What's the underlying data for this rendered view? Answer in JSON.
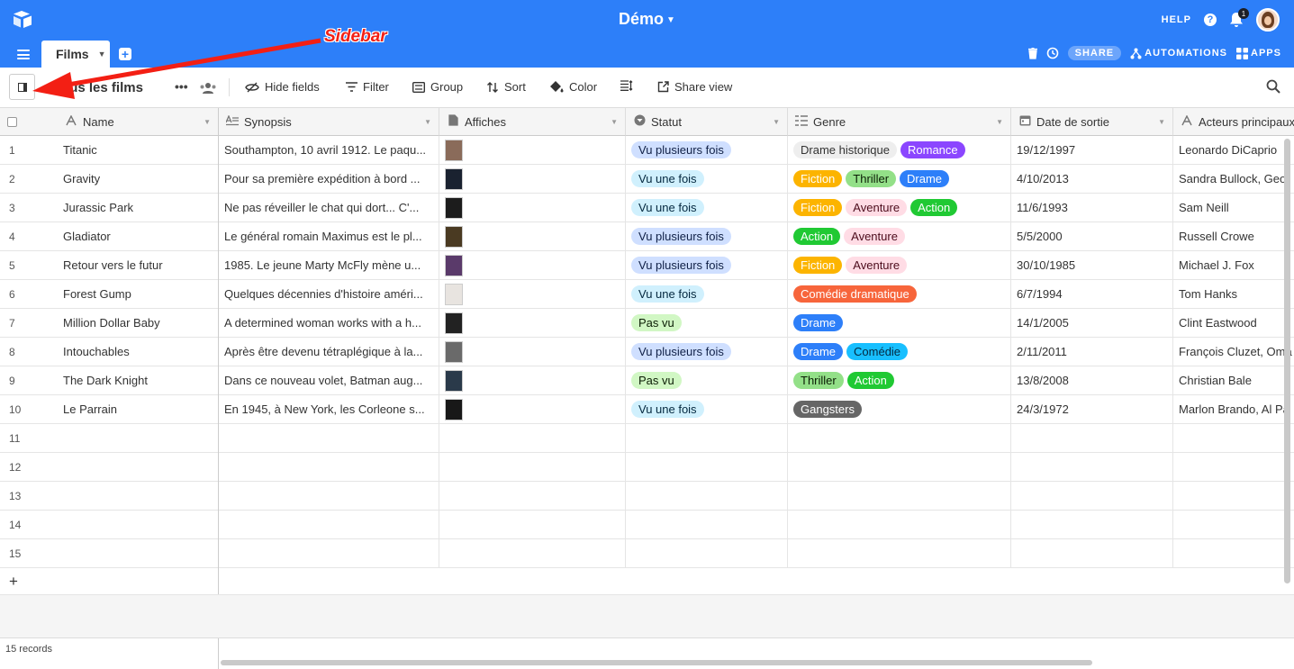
{
  "app": {
    "base_title": "Démo",
    "help_label": "HELP",
    "help_icon_glyph": "?",
    "notification_count": "1"
  },
  "tabs": {
    "active": "Films"
  },
  "tab_actions": {
    "share": "SHARE",
    "automations": "AUTOMATIONS",
    "apps": "APPS"
  },
  "toolbar": {
    "view_name": "Tous les films",
    "more": "•••",
    "hide_fields": "Hide fields",
    "filter": "Filter",
    "group": "Group",
    "sort": "Sort",
    "color": "Color",
    "share_view": "Share view"
  },
  "annotation": {
    "label": "Sidebar",
    "color": "#f31f14"
  },
  "columns": [
    {
      "label": "Name",
      "icon": "text-icon"
    },
    {
      "label": "Synopsis",
      "icon": "long-text-icon"
    },
    {
      "label": "Affiches",
      "icon": "attachment-icon"
    },
    {
      "label": "Statut",
      "icon": "single-select-icon"
    },
    {
      "label": "Genre",
      "icon": "multi-select-icon"
    },
    {
      "label": "Date de sortie",
      "icon": "calendar-icon"
    },
    {
      "label": "Acteurs principaux",
      "icon": "text-icon"
    }
  ],
  "status_colors": {
    "Vu plusieurs fois": {
      "bg": "#cfdfff",
      "fg": "#102046"
    },
    "Vu une fois": {
      "bg": "#d0f0fd",
      "fg": "#04283f"
    },
    "Pas vu": {
      "bg": "#d1f7c4",
      "fg": "#0b1d05"
    }
  },
  "genre_colors": {
    "Drame historique": {
      "bg": "#eeeeee",
      "fg": "#333333"
    },
    "Romance": {
      "bg": "#8b46ff",
      "fg": "#ffffff"
    },
    "Fiction": {
      "bg": "#fcb400",
      "fg": "#ffffff"
    },
    "Thriller": {
      "bg": "#93e088",
      "fg": "#0b1d05"
    },
    "Drame": {
      "bg": "#2d7ff9",
      "fg": "#ffffff"
    },
    "Aventure": {
      "bg": "#ffdce5",
      "fg": "#4c0c1c"
    },
    "Action": {
      "bg": "#20c933",
      "fg": "#ffffff"
    },
    "Comédie dramatique": {
      "bg": "#f7653b",
      "fg": "#ffffff"
    },
    "Comédie": {
      "bg": "#18bfff",
      "fg": "#04283f"
    },
    "Gangsters": {
      "bg": "#666666",
      "fg": "#ffffff"
    }
  },
  "rows": [
    {
      "num": "1",
      "name": "Titanic",
      "synopsis": "Southampton, 10 avril 1912. Le paqu...",
      "poster": "#8a6b5a",
      "status": "Vu plusieurs fois",
      "genres": [
        "Drame historique",
        "Romance"
      ],
      "date": "19/12/1997",
      "actors": "Leonardo DiCaprio"
    },
    {
      "num": "2",
      "name": "Gravity",
      "synopsis": "Pour sa première expédition à bord ...",
      "poster": "#1a2230",
      "status": "Vu une fois",
      "genres": [
        "Fiction",
        "Thriller",
        "Drame"
      ],
      "date": "4/10/2013",
      "actors": "Sandra Bullock, Geor"
    },
    {
      "num": "3",
      "name": "Jurassic Park",
      "synopsis": "Ne pas réveiller le chat qui dort... C'...",
      "poster": "#1c1c1c",
      "status": "Vu une fois",
      "genres": [
        "Fiction",
        "Aventure",
        "Action"
      ],
      "date": "11/6/1993",
      "actors": "Sam Neill"
    },
    {
      "num": "4",
      "name": "Gladiator",
      "synopsis": "Le général romain Maximus est le pl...",
      "poster": "#4a3a22",
      "status": "Vu plusieurs fois",
      "genres": [
        "Action",
        "Aventure"
      ],
      "date": "5/5/2000",
      "actors": "Russell Crowe"
    },
    {
      "num": "5",
      "name": "Retour vers le futur",
      "synopsis": "1985. Le jeune Marty McFly mène u...",
      "poster": "#5a3a6a",
      "status": "Vu plusieurs fois",
      "genres": [
        "Fiction",
        "Aventure"
      ],
      "date": "30/10/1985",
      "actors": "Michael J. Fox"
    },
    {
      "num": "6",
      "name": "Forest Gump",
      "synopsis": "Quelques décennies d'histoire améri...",
      "poster": "#e8e4e0",
      "status": "Vu une fois",
      "genres": [
        "Comédie dramatique"
      ],
      "date": "6/7/1994",
      "actors": "Tom Hanks"
    },
    {
      "num": "7",
      "name": "Million Dollar Baby",
      "synopsis": "A determined woman works with a h...",
      "poster": "#222222",
      "status": "Pas vu",
      "genres": [
        "Drame"
      ],
      "date": "14/1/2005",
      "actors": "Clint Eastwood"
    },
    {
      "num": "8",
      "name": "Intouchables",
      "synopsis": "Après être devenu tétraplégique à la...",
      "poster": "#6a6a6a",
      "status": "Vu plusieurs fois",
      "genres": [
        "Drame",
        "Comédie"
      ],
      "date": "2/11/2011",
      "actors": "François Cluzet, Oma"
    },
    {
      "num": "9",
      "name": "The Dark Knight",
      "synopsis": "Dans ce nouveau volet, Batman aug...",
      "poster": "#2a3a4a",
      "status": "Pas vu",
      "genres": [
        "Thriller",
        "Action"
      ],
      "date": "13/8/2008",
      "actors": "Christian Bale"
    },
    {
      "num": "10",
      "name": "Le Parrain",
      "synopsis": "En 1945, à New York, les Corleone s...",
      "poster": "#181818",
      "status": "Vu une fois",
      "genres": [
        "Gangsters"
      ],
      "date": "24/3/1972",
      "actors": "Marlon Brando, Al Pa"
    }
  ],
  "empty_rows": [
    "11",
    "12",
    "13",
    "14",
    "15"
  ],
  "add_row_label": "+",
  "footer": {
    "records": "15 records"
  }
}
